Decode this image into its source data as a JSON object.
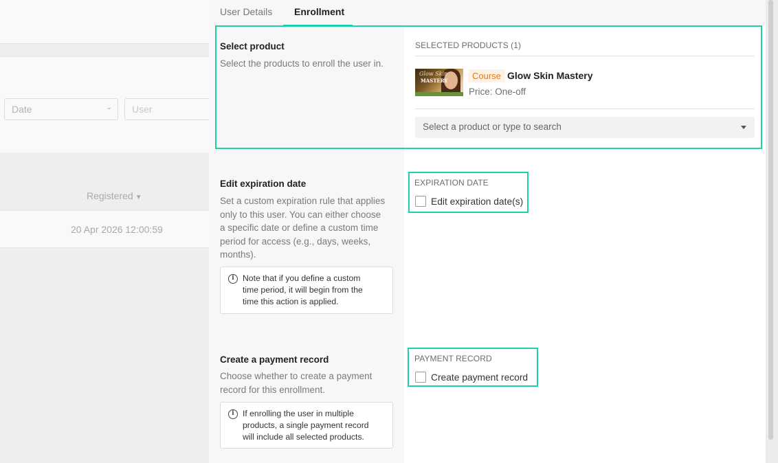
{
  "background": {
    "date_select": "Date",
    "user_input_placeholder": "User",
    "column_header": "Registered",
    "row_value": "20 Apr 2026 12:00:59"
  },
  "tabs": [
    {
      "label": "User Details",
      "active": false
    },
    {
      "label": "Enrollment",
      "active": true
    }
  ],
  "select_product": {
    "title": "Select product",
    "description": "Select the products to enroll the user in.",
    "selected_label": "SELECTED PRODUCTS (1)",
    "product": {
      "type_badge": "Course",
      "name": "Glow Skin Mastery",
      "price": "Price: One-off",
      "thumb_line1": "Glow Skin",
      "thumb_line2": "MASTERY"
    },
    "search_placeholder": "Select a product or type to search"
  },
  "expiration": {
    "title": "Edit expiration date",
    "description_lines": [
      "Set a custom expiration rule that applies",
      "only to this user. You can either choose",
      "a specific date or define a custom time",
      "period for access (e.g., days, weeks,",
      "months)."
    ],
    "note_lines": [
      "Note that if you define a custom",
      "time period, it will begin from the",
      "time this action is applied."
    ],
    "right_label": "EXPIRATION DATE",
    "checkbox_label": "Edit expiration date(s)",
    "checked": false
  },
  "payment": {
    "title": "Create a payment record",
    "description_lines": [
      "Choose whether to create a payment",
      "record for this enrollment."
    ],
    "note_lines": [
      "If enrolling the user in multiple",
      "products, a single payment record",
      "will include all selected products."
    ],
    "right_label": "PAYMENT RECORD",
    "checkbox_label": "Create payment record",
    "checked": false
  },
  "colors": {
    "accent": "#1cc9a7",
    "highlight": "#1fcfa5",
    "badge_text": "#e37b1c"
  }
}
